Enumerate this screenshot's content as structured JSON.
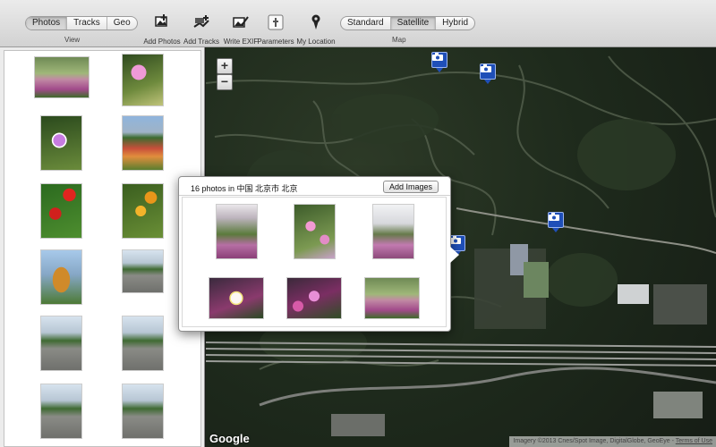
{
  "toolbar": {
    "view_segment": [
      "Photos",
      "Tracks",
      "Geo"
    ],
    "view_selected": "Photos",
    "view_label": "View",
    "buttons": {
      "add_photos": "Add Photos",
      "add_tracks": "Add Tracks",
      "write_exif": "Write EXIF",
      "parameters": "Parameters",
      "my_location": "My Location"
    },
    "map_segment": [
      "Standard",
      "Satellite",
      "Hybrid"
    ],
    "map_selected": "Satellite",
    "map_label": "Map"
  },
  "sidebar": {
    "photos": [
      {
        "name": "photo-1",
        "kind": "people"
      },
      {
        "name": "photo-2",
        "kind": "cosmos"
      },
      {
        "name": "photo-3",
        "kind": "cosmos2"
      },
      {
        "name": "photo-4",
        "kind": "field"
      },
      {
        "name": "photo-5",
        "kind": "red"
      },
      {
        "name": "photo-6",
        "kind": "yellow"
      },
      {
        "name": "photo-7",
        "kind": "statue"
      },
      {
        "name": "photo-8",
        "kind": "road"
      },
      {
        "name": "photo-9",
        "kind": "road"
      },
      {
        "name": "photo-10",
        "kind": "road"
      },
      {
        "name": "photo-11",
        "kind": "road"
      },
      {
        "name": "photo-12",
        "kind": "road"
      }
    ]
  },
  "map": {
    "zoom_in": "+",
    "zoom_out": "−",
    "logo": "Google",
    "credits": "Imagery ©2013 Cnes/Spot Image, DigitalGlobe, GeoEye",
    "terms": "Terms of Use"
  },
  "popover": {
    "title": "16 photos in 中国 北京市 北京",
    "add_images": "Add Images",
    "photos": [
      "girl",
      "pink",
      "pinkgirl",
      "white",
      "magenta",
      "people"
    ]
  },
  "colors": {
    "pin_blue": "#1f4fb8",
    "toolbar_top": "#ebebeb",
    "toolbar_bottom": "#d2d2d2"
  }
}
